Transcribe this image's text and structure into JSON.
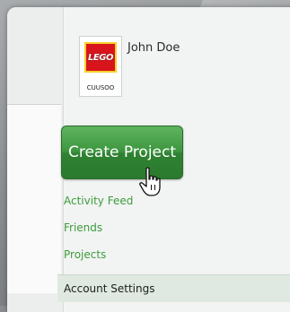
{
  "profile": {
    "name": "John Doe",
    "logo_text": "LEGO",
    "logo_caption": "CUUSOO"
  },
  "actions": {
    "create_project_label": "Create Project"
  },
  "nav": {
    "items": [
      {
        "label": "Activity Feed"
      },
      {
        "label": "Friends"
      },
      {
        "label": "Projects"
      }
    ],
    "settings_label": "Account Settings"
  },
  "colors": {
    "accent_green": "#3e9a3e",
    "button_green": "#3d963f",
    "logo_red": "#d8141c",
    "logo_yellow": "#f6d12b"
  },
  "icons": {
    "cursor": "hand-pointer-icon"
  }
}
